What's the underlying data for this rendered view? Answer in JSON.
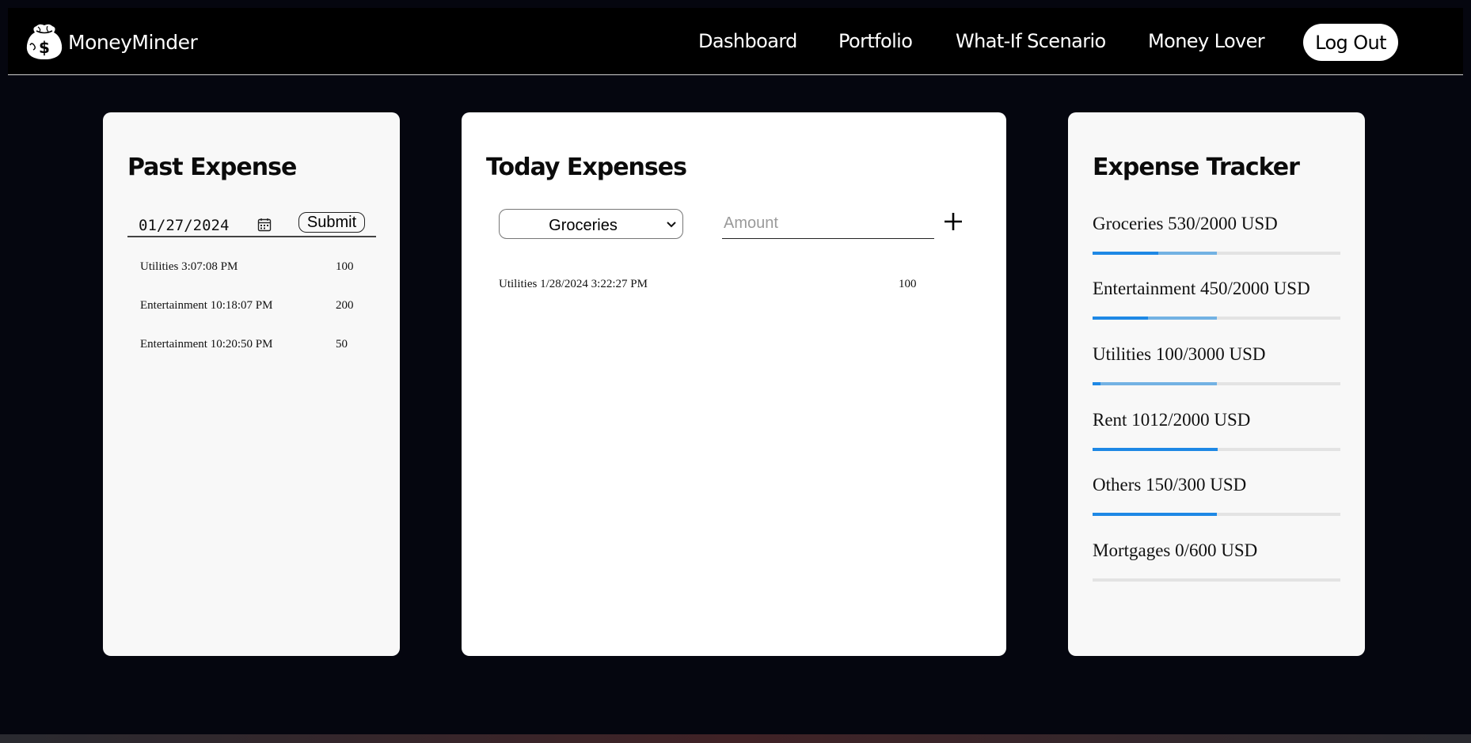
{
  "nav": {
    "brand": "MoneyMinder",
    "links": [
      "Dashboard",
      "Portfolio",
      "What-If Scenario",
      "Money Lover"
    ],
    "logout": "Log Out"
  },
  "past_expense": {
    "title": "Past Expense",
    "date_value": "01/27/2024",
    "submit_label": "Submit",
    "items": [
      {
        "label": "Utilities 3:07:08 PM",
        "amount": "100"
      },
      {
        "label": "Entertainment 10:18:07 PM",
        "amount": "200"
      },
      {
        "label": "Entertainment 10:20:50 PM",
        "amount": "50"
      }
    ]
  },
  "today_expenses": {
    "title": "Today Expenses",
    "category_selected": "Groceries",
    "amount_placeholder": "Amount",
    "items": [
      {
        "label": "Utilities 1/28/2024 3:22:27 PM",
        "amount": "100"
      }
    ]
  },
  "expense_tracker": {
    "title": "Expense Tracker",
    "items": [
      {
        "label": "Groceries 530/2000 USD",
        "progress": 0.265,
        "buffer": 0.5
      },
      {
        "label": "Entertainment 450/2000 USD",
        "progress": 0.225,
        "buffer": 0.5
      },
      {
        "label": "Utilities 100/3000 USD",
        "progress": 0.033,
        "buffer": 0.5
      },
      {
        "label": "Rent 1012/2000 USD",
        "progress": 0.506,
        "buffer": 0.5
      },
      {
        "label": "Others 150/300 USD",
        "progress": 0.5,
        "buffer": 0.5
      },
      {
        "label": "Mortgages 0/600 USD",
        "progress": 0,
        "buffer": 0
      }
    ]
  },
  "colors": {
    "background": "#05060f",
    "card": "#f8f8f8",
    "progress": "#1e88e5",
    "progress_buffer": "#73b2e3",
    "track": "#e3e3e3"
  },
  "icons": {
    "logo": "money-bag-brain-icon",
    "calendar": "calendar-icon",
    "select": "chevron-down-icon",
    "add": "plus-icon"
  }
}
